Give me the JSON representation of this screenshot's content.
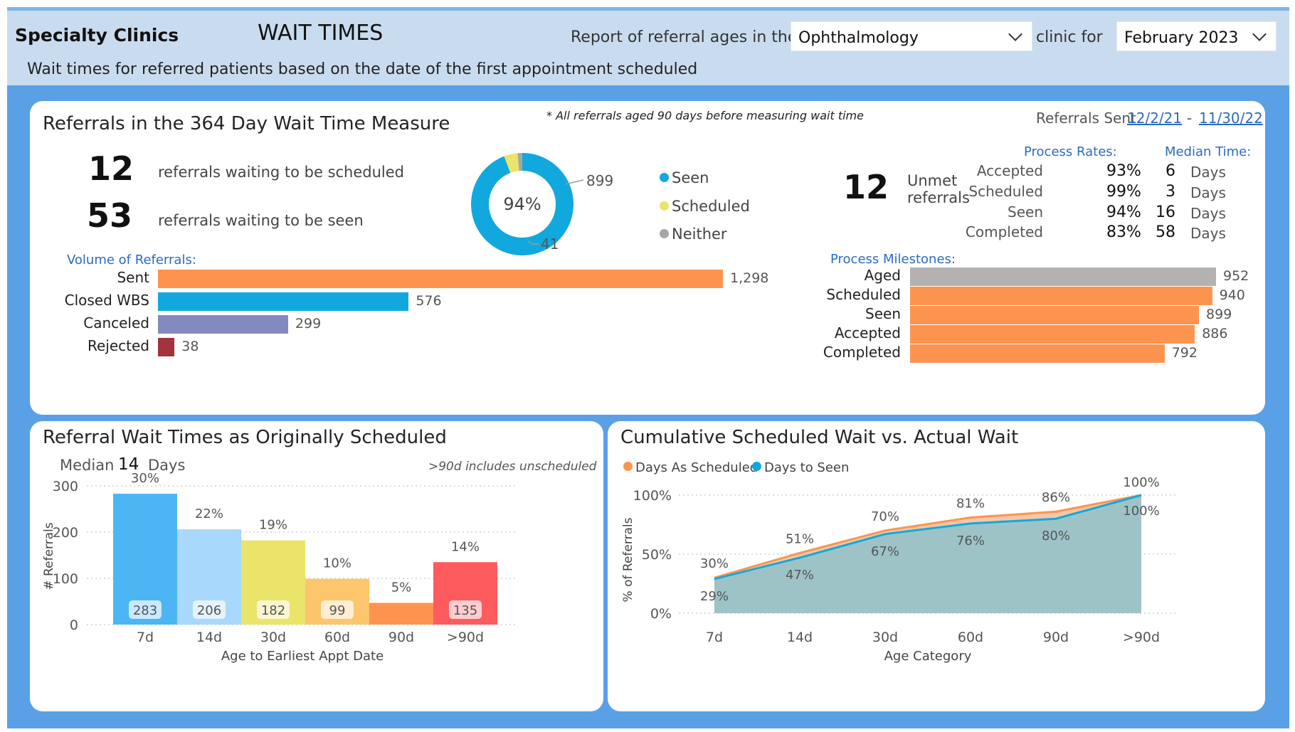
{
  "header": {
    "brand": "Specialty Clinics",
    "title": "WAIT TIMES",
    "report_label": "Report of referral ages in the",
    "clinic_select": "Ophthalmology",
    "clinic_for_label": "clinic for",
    "month_select": "February 2023",
    "subtitle": "Wait times for referred patients based on the date of the first appointment scheduled"
  },
  "colors": {
    "accent_blue": "#11a9dd",
    "orange": "#fc9450",
    "purple": "#8589c1",
    "dark_red": "#a1343c",
    "grey": "#b4b1b1",
    "yellow": "#eae46a"
  },
  "measure": {
    "title": "Referrals in the 364 Day Wait Time Measure",
    "note": "* All referrals aged 90 days before measuring wait time",
    "sent_label": "Referrals Sent",
    "date_from": "12/2/21",
    "date_sep": "-",
    "date_to": "11/30/22",
    "kpi1_value": "12",
    "kpi1_label": "referrals waiting to be scheduled",
    "kpi2_value": "53",
    "kpi2_label": "referrals waiting to be seen",
    "donut": {
      "center": "94%",
      "seen_value": "899",
      "neither_value": "41",
      "slices": [
        {
          "name": "Seen",
          "value": 899,
          "color": "#11a9dd"
        },
        {
          "name": "Scheduled",
          "value": 41,
          "color": "#eae46a"
        },
        {
          "name": "Neither",
          "value": 14,
          "color": "#a6a6a6"
        }
      ],
      "legend": [
        "Seen",
        "Scheduled",
        "Neither"
      ]
    },
    "unmet_value": "12",
    "unmet_label_1": "Unmet",
    "unmet_label_2": "referrals",
    "rates_header": "Process Rates:",
    "median_header": "Median Time:",
    "rates": [
      {
        "label": "Accepted",
        "pct": "93%",
        "days": "6",
        "unit": "Days"
      },
      {
        "label": "Scheduled",
        "pct": "99%",
        "days": "3",
        "unit": "Days"
      },
      {
        "label": "Seen",
        "pct": "94%",
        "days": "16",
        "unit": "Days"
      },
      {
        "label": "Completed",
        "pct": "83%",
        "days": "58",
        "unit": "Days"
      }
    ],
    "volume_header": "Volume of Referrals:",
    "volume": [
      {
        "label": "Sent",
        "value": 1298,
        "display": "1,298",
        "color": "#fc9450"
      },
      {
        "label": "Closed WBS",
        "value": 576,
        "display": "576",
        "color": "#11a9dd"
      },
      {
        "label": "Canceled",
        "value": 299,
        "display": "299",
        "color": "#8589c1"
      },
      {
        "label": "Rejected",
        "value": 38,
        "display": "38",
        "color": "#a1343c"
      }
    ],
    "milestones_header": "Process Milestones:",
    "milestones": [
      {
        "label": "Aged",
        "value": 952,
        "display": "952",
        "color": "#b4b1b1"
      },
      {
        "label": "Scheduled",
        "value": 940,
        "display": "940",
        "color": "#fc9450"
      },
      {
        "label": "Seen",
        "value": 899,
        "display": "899",
        "color": "#fc9450"
      },
      {
        "label": "Accepted",
        "value": 886,
        "display": "886",
        "color": "#fc9450"
      },
      {
        "label": "Completed",
        "value": 792,
        "display": "792",
        "color": "#fc9450"
      }
    ]
  },
  "orig": {
    "title": "Referral Wait Times as Originally Scheduled",
    "median_label": "Median",
    "median_value": "14",
    "median_unit": "Days",
    "note": ">90d includes unscheduled"
  },
  "cumul": {
    "title": "Cumulative Scheduled Wait vs. Actual Wait"
  },
  "chart_data": [
    {
      "type": "bar",
      "title": "Referral Wait Times as Originally Scheduled",
      "xlabel": "Age to Earliest Appt Date",
      "ylabel": "# Referrals",
      "ylim": [
        0,
        300
      ],
      "yticks": [
        0,
        100,
        200,
        300
      ],
      "categories": [
        "7d",
        "14d",
        "30d",
        "60d",
        "90d",
        ">90d"
      ],
      "values": [
        283,
        206,
        182,
        99,
        47,
        135
      ],
      "value_labels": [
        "283",
        "206",
        "182",
        "99",
        "",
        "135"
      ],
      "percent_labels": [
        "30%",
        "22%",
        "19%",
        "10%",
        "5%",
        "14%"
      ],
      "colors": [
        "#4cb6f5",
        "#a8d8fb",
        "#eae46a",
        "#fdc56c",
        "#fc9450",
        "#fd5b5e"
      ],
      "grid": true
    },
    {
      "type": "area",
      "title": "Cumulative Scheduled Wait vs. Actual Wait",
      "xlabel": "Age Category",
      "ylabel": "% of Referrals",
      "ylim": [
        0,
        100
      ],
      "yticks": [
        "0%",
        "50%",
        "100%"
      ],
      "categories": [
        "7d",
        "14d",
        "30d",
        "60d",
        "90d",
        ">90d"
      ],
      "series": [
        {
          "name": "Days As Scheduled",
          "values": [
            30,
            51,
            70,
            81,
            86,
            100
          ],
          "labels": [
            "30%",
            "51%",
            "70%",
            "81%",
            "86%",
            "100%"
          ],
          "color": "#fc9450"
        },
        {
          "name": "Days to Seen",
          "values": [
            29,
            47,
            67,
            76,
            80,
            100
          ],
          "labels": [
            "29%",
            "47%",
            "67%",
            "76%",
            "80%",
            "100%"
          ],
          "color": "#11a9dd"
        }
      ],
      "legend": "top-left",
      "grid": true
    }
  ]
}
